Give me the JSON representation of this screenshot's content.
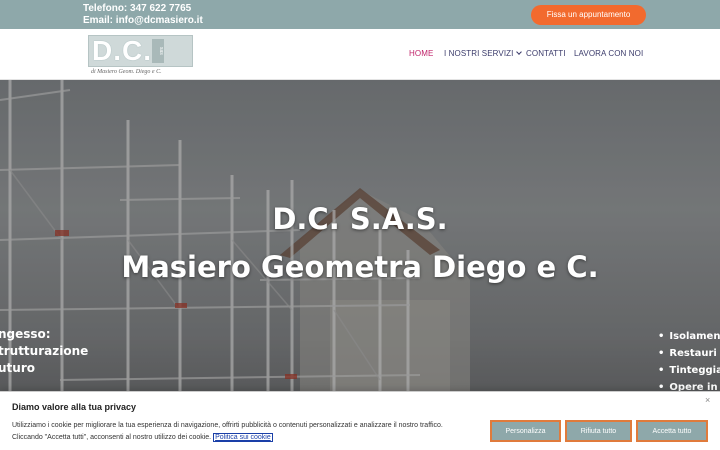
{
  "topbar": {
    "phone": "Telefono: 347 622 7765",
    "email": "Email: info@dcmasiero.it",
    "cta_label": "Fissa un appuntamento"
  },
  "logo": {
    "letters": "D.C.",
    "tag": "sas",
    "subtitle": "di Masiero Geom. Diego e C."
  },
  "nav": {
    "home": "HOME",
    "services": "I NOSTRI SERVIZI",
    "contacts": "CONTATTI",
    "work": "LAVORA CON NOI"
  },
  "hero": {
    "title": "D.C. S.A.S.",
    "subtitle": "Masiero Geometra Diego e C.",
    "left_items": [
      "ngesso:",
      "trutturazione",
      "uturo"
    ],
    "right_items": [
      "Isolamento",
      "Restauri e R",
      "Tinteggiatu",
      "Opere in Ca"
    ]
  },
  "cookie": {
    "title": "Diamo valore alla tua privacy",
    "text_1": "Utilizziamo i cookie per migliorare la tua esperienza di navigazione, offrirti pubblicità o contenuti personalizzati e analizzare il nostro traffico.",
    "text_2": "Cliccando \"Accetta tutti\", acconsenti al nostro utilizzo dei cookie.",
    "policy_link": "Politica sui cookie",
    "close": "×",
    "btn_customize": "Personalizza",
    "btn_reject": "Rifiuta tutto",
    "btn_accept": "Accetta tutto"
  },
  "colors": {
    "topbar": "#8ea8aa",
    "cta": "#f26a2e",
    "nav_active": "#c0246a",
    "nav_text": "#3b3b6b",
    "button_border": "#e07b3c"
  }
}
